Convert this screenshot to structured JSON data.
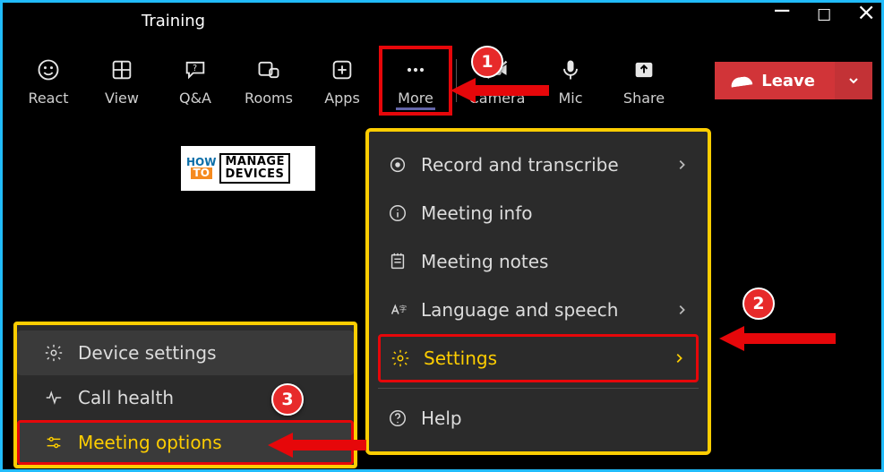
{
  "window": {
    "title": "Training"
  },
  "toolbar": {
    "react": "React",
    "view": "View",
    "qa": "Q&A",
    "rooms": "Rooms",
    "apps": "Apps",
    "more": "More",
    "camera": "Camera",
    "mic": "Mic",
    "share": "Share",
    "leave": "Leave"
  },
  "more_menu": {
    "record": "Record and transcribe",
    "info": "Meeting info",
    "notes": "Meeting notes",
    "lang": "Language and speech",
    "settings": "Settings",
    "help": "Help"
  },
  "settings_menu": {
    "device": "Device settings",
    "health": "Call health",
    "meeting_options": "Meeting options"
  },
  "callouts": {
    "b1": "1",
    "b2": "2",
    "b3": "3"
  },
  "logo": {
    "how": "HOW",
    "to": "TO",
    "manage": "MANAGE",
    "devices": "DEVICES"
  }
}
